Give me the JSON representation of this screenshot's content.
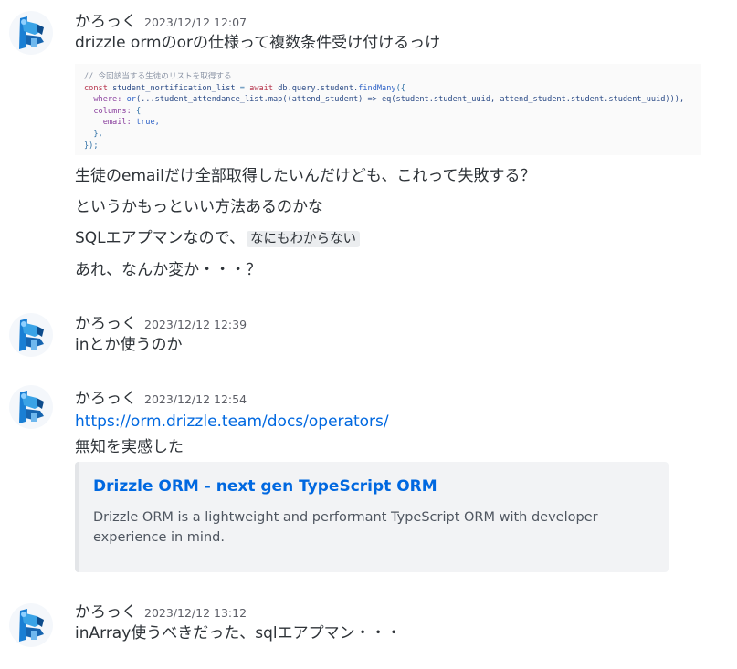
{
  "colors": {
    "link": "#0068e0",
    "text": "#2e3338",
    "timestamp": "#5c5e66",
    "embed_bg": "#f2f3f5"
  },
  "messages": [
    {
      "username": "かろっく",
      "timestamp": "2023/12/12 12:07",
      "lines": [
        "drizzle ormのorの仕様って複数条件受け付けるっけ"
      ],
      "code_image": {
        "comment": "// 今回該当する生徒のリストを取得する",
        "l1_const": "const",
        "l1_var": "student_nortification_list",
        "l1_eq": "=",
        "l1_await": "await",
        "l1_obj": "db.query.student.",
        "l1_fn": "findMany",
        "l1_end": "({",
        "l2_key": "where:",
        "l2_fn": "or",
        "l2_rest": "(...student_attendance_list.map((attend_student) => eq(student.student_uuid, attend_student.student.student_uuid))),",
        "l3_key": "columns:",
        "l3_rest": "{",
        "l4_key": "email:",
        "l4_val": "true,",
        "l5": "},",
        "l6": "});"
      },
      "after_lines": [
        "生徒のemailだけ全部取得したいんだけども、これって失敗する？",
        "というかもっといい方法あるのかな"
      ],
      "sql_line_prefix": "SQLエアプマンなので、",
      "sql_line_code": "なにもわからない",
      "last_line": "あれ、なんか変か・・・？"
    },
    {
      "username": "かろっく",
      "timestamp": "2023/12/12 12:39",
      "text": "inとか使うのか"
    },
    {
      "username": "かろっく",
      "timestamp": "2023/12/12 12:54",
      "link": "https://orm.drizzle.team/docs/operators/",
      "text": "無知を実感した",
      "embed": {
        "title": "Drizzle ORM - next gen TypeScript ORM",
        "description": "Drizzle ORM is a lightweight and performant TypeScript ORM with developer experience in mind."
      }
    },
    {
      "username": "かろっく",
      "timestamp": "2023/12/12 13:12",
      "text": "inArray使うべきだった、sqlエアプマン・・・"
    }
  ]
}
